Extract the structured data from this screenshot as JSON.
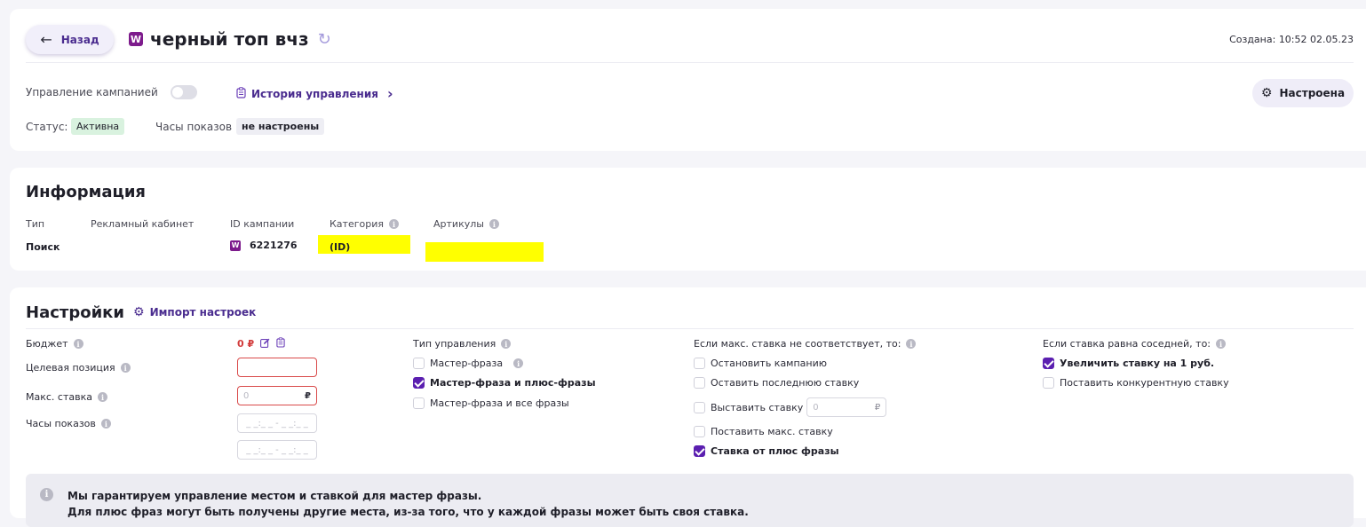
{
  "header": {
    "back_label": "Назад",
    "back_arrow": "←",
    "brand_icon": "W",
    "campaign_name": "черный топ вчз",
    "refresh_icon": "↻",
    "created_label": "Создана:",
    "created_value": "10:52 02.05.23"
  },
  "management": {
    "label": "Управление кампанией",
    "history_label": "История управления",
    "history_chevron": "›",
    "configured_label": "Настроена",
    "gear_icon": "⚙"
  },
  "status": {
    "label": "Статус:",
    "value": "Активна",
    "hours_label": "Часы показов",
    "hours_value": "не настроены"
  },
  "info": {
    "title": "Информация",
    "columns": [
      "Тип",
      "Рекламный кабинет",
      "ID кампании",
      "Категория",
      "Артикулы"
    ],
    "type_value": "Поиск",
    "campaign_id": "6221276",
    "category_value": "(ID)"
  },
  "settings": {
    "title": "Настройки",
    "import_label": "Импорт настроек",
    "budget_label": "Бюджет",
    "budget_value": "0 ₽",
    "target_position_label": "Целевая позиция",
    "max_bid_label": "Макс. ставка",
    "max_bid_placeholder": "0",
    "currency": "₽",
    "hours_label": "Часы показов",
    "hours_placeholder": "_ _:_ _  -  _ _:_ _",
    "control_type_label": "Тип управления",
    "control_options": [
      {
        "label": "Мастер-фраза",
        "checked": false
      },
      {
        "label": "Мастер-фраза и плюс-фразы",
        "checked": true
      },
      {
        "label": "Мастер-фраза и все фразы",
        "checked": false
      }
    ],
    "mismatch_label": "Если макс. ставка не соответствует, то:",
    "mismatch_options": [
      {
        "label": "Остановить кампанию",
        "checked": false
      },
      {
        "label": "Оставить последнюю ставку",
        "checked": false
      },
      {
        "label": "Выставить ставку",
        "checked": false
      },
      {
        "label": "Поставить макс. ставку",
        "checked": false
      },
      {
        "label": "Ставка от плюс фразы",
        "checked": true
      }
    ],
    "equal_label": "Если ставка равна соседней, то:",
    "equal_options": [
      {
        "label": "Увеличить ставку на 1 руб.",
        "checked": true
      },
      {
        "label": "Поставить конкурентную ставку",
        "checked": false
      }
    ],
    "notice_line1": "Мы гарантируем управление местом и ставкой для мастер фразы.",
    "notice_line2": "Для плюс фраз могут быть получены другие места, из-за того, что у каждой фразы может быть своя ставка."
  },
  "colors": {
    "accent": "#4a2c8f",
    "brand": "#7d1b8c",
    "checked": "#5b1fb0",
    "active_badge": "#d9f2df",
    "redaction": "#ffff00"
  }
}
